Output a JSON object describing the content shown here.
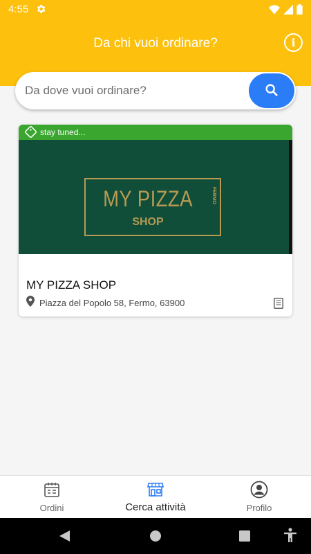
{
  "status_bar": {
    "time": "4:55",
    "icons": [
      "gear-icon",
      "wifi-icon",
      "signal-icon",
      "battery-icon"
    ]
  },
  "header": {
    "title": "Da chi vuoi ordinare?",
    "info_icon": "info-icon"
  },
  "search": {
    "placeholder": "Da dove vuoi ordinare?",
    "value": "",
    "button_icon": "search-icon"
  },
  "shop_card": {
    "badge": "stay tuned...",
    "logo": {
      "main": "MY PIZZA",
      "sub": "SHOP",
      "side": "FERMO"
    },
    "name": "MY PIZZA SHOP",
    "address": "Piazza del Popolo 58, Fermo, 63900",
    "menu_icon": "menu-book-icon"
  },
  "bottom_nav": {
    "items": [
      {
        "label": "Ordini",
        "icon": "orders-icon",
        "active": false
      },
      {
        "label": "Cerca attività",
        "icon": "store-icon",
        "active": true
      },
      {
        "label": "Profilo",
        "icon": "profile-icon",
        "active": false
      }
    ]
  },
  "system_nav": [
    "back-icon",
    "home-icon",
    "recents-icon",
    "accessibility-icon"
  ],
  "colors": {
    "header": "#fcc00d",
    "search_button": "#2a7df6",
    "badge": "#3aa52f",
    "logo_bg": "#104e3a",
    "logo_gold": "#b79a52",
    "active_tab": "#2a7df6"
  }
}
